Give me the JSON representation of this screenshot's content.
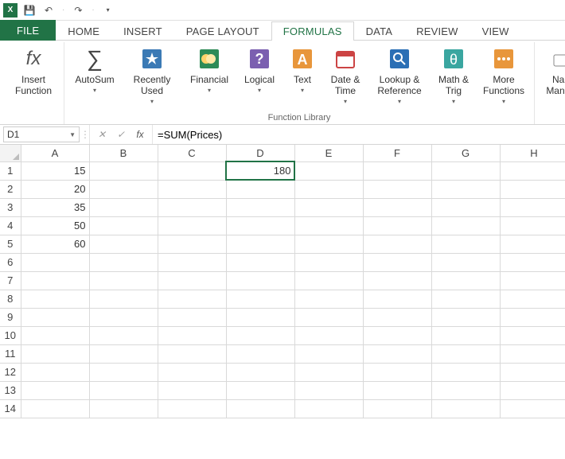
{
  "qat": {
    "logo_text": "X",
    "save_icon": "💾",
    "undo_icon": "↶",
    "redo_icon": "↷",
    "dropdown_icon": "▾"
  },
  "tabs": {
    "file": "FILE",
    "home": "HOME",
    "insert": "INSERT",
    "page_layout": "PAGE LAYOUT",
    "formulas": "FORMULAS",
    "data": "DATA",
    "review": "REVIEW",
    "view": "VIEW"
  },
  "ribbon": {
    "insert_function": "Insert\nFunction",
    "autosum": "AutoSum",
    "recently_used": "Recently\nUsed",
    "financial": "Financial",
    "logical": "Logical",
    "text": "Text",
    "date_time": "Date &\nTime",
    "lookup_ref": "Lookup &\nReference",
    "math_trig": "Math &\nTrig",
    "more_functions": "More\nFunctions",
    "name_manager": "Name\nManager",
    "group_label": "Function Library",
    "dd": "▾"
  },
  "formula_bar": {
    "name_box": "D1",
    "cancel": "✕",
    "enter": "✓",
    "fx": "fx",
    "formula": "=SUM(Prices)"
  },
  "grid": {
    "columns": [
      "A",
      "B",
      "C",
      "D",
      "E",
      "F",
      "G",
      "H"
    ],
    "rows": [
      "1",
      "2",
      "3",
      "4",
      "5",
      "6",
      "7",
      "8",
      "9",
      "10",
      "11",
      "12",
      "13",
      "14"
    ],
    "cells": {
      "A1": "15",
      "A2": "20",
      "A3": "35",
      "A4": "50",
      "A5": "60",
      "D1": "180"
    },
    "selected": "D1"
  },
  "chart_data": {
    "type": "table",
    "columns": [
      "A",
      "B",
      "C",
      "D",
      "E",
      "F",
      "G",
      "H"
    ],
    "data": [
      [
        15,
        null,
        null,
        180,
        null,
        null,
        null,
        null
      ],
      [
        20,
        null,
        null,
        null,
        null,
        null,
        null,
        null
      ],
      [
        35,
        null,
        null,
        null,
        null,
        null,
        null,
        null
      ],
      [
        50,
        null,
        null,
        null,
        null,
        null,
        null,
        null
      ],
      [
        60,
        null,
        null,
        null,
        null,
        null,
        null,
        null
      ]
    ],
    "formulas": {
      "D1": "=SUM(Prices)"
    }
  }
}
